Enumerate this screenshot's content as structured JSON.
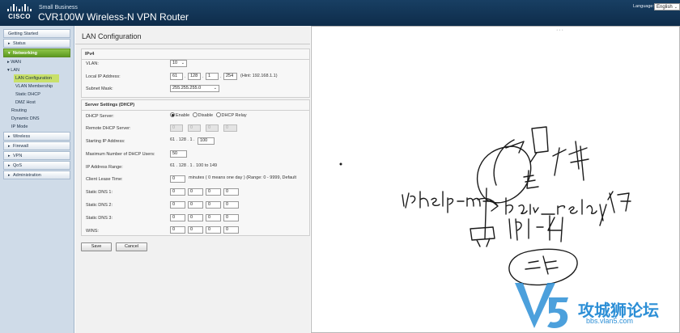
{
  "header": {
    "logo_text": "CISCO",
    "brand_line": "Small Business",
    "product_title": "CVR100W Wireless-N VPN Router",
    "language_label": "Language:",
    "language_value": "English"
  },
  "sidebar": {
    "items": [
      {
        "label": "Getting Started",
        "kind": "section"
      },
      {
        "label": "Status",
        "kind": "collapsed"
      },
      {
        "label": "Networking",
        "kind": "active"
      },
      {
        "label": "WAN",
        "kind": "sub-collapsed"
      },
      {
        "label": "LAN",
        "kind": "sub-expanded"
      },
      {
        "label": "LAN Configuration",
        "kind": "current"
      },
      {
        "label": "VLAN Membership",
        "kind": "leaf"
      },
      {
        "label": "Static DHCP",
        "kind": "leaf"
      },
      {
        "label": "DMZ Host",
        "kind": "leaf"
      },
      {
        "label": "Routing",
        "kind": "sub"
      },
      {
        "label": "Dynamic DNS",
        "kind": "sub"
      },
      {
        "label": "IP Mode",
        "kind": "sub"
      },
      {
        "label": "Wireless",
        "kind": "collapsed"
      },
      {
        "label": "Firewall",
        "kind": "collapsed"
      },
      {
        "label": "VPN",
        "kind": "collapsed"
      },
      {
        "label": "QoS",
        "kind": "collapsed"
      },
      {
        "label": "Administration",
        "kind": "collapsed"
      }
    ]
  },
  "main": {
    "title": "LAN Configuration",
    "ipv4": {
      "heading": "IPv4",
      "vlan_label": "VLAN:",
      "vlan_value": "10",
      "local_ip_label": "Local IP Address:",
      "local_ip": [
        "61",
        "128",
        "1",
        "254"
      ],
      "local_ip_hint": "(Hint: 192.168.1.1)",
      "subnet_label": "Subnet Mask:",
      "subnet_value": "255.255.255.0"
    },
    "dhcp": {
      "heading": "Server Settings (DHCP)",
      "server_label": "DHCP Server:",
      "options": [
        "Enable",
        "Disable",
        "DHCP Relay"
      ],
      "selected": "Enable",
      "remote_label": "Remote DHCP Server:",
      "remote_ip": [
        "0",
        "0",
        "0",
        "0"
      ],
      "start_label": "Starting IP Address:",
      "start_prefix": "61 . 128 . 1 .",
      "start_last": "100",
      "max_users_label": "Maximum Number of DHCP Users:",
      "max_users": "50",
      "range_label": "IP Address Range:",
      "range_value": "61 . 128 . 1 . 100 to 149",
      "lease_label": "Client Lease Time:",
      "lease_value": "0",
      "lease_hint": "minutes ( 0 means one day ) (Range: 0 - 9999, Default",
      "dns1_label": "Static DNS 1:",
      "dns1": [
        "0",
        "0",
        "0",
        "0"
      ],
      "dns2_label": "Static DNS 2:",
      "dns2": [
        "0",
        "0",
        "0",
        "0"
      ],
      "dns3_label": "Static DNS 3:",
      "dns3": [
        "0",
        "0",
        "0",
        "0"
      ],
      "wins_label": "WINS:",
      "wins": [
        "0",
        "0",
        "0",
        "0"
      ]
    },
    "buttons": {
      "save": "Save",
      "cancel": "Cancel"
    }
  },
  "overlay": {
    "grip": "···",
    "ink_color": "#1a1a1a"
  },
  "watermark": {
    "text": "攻城狮论坛",
    "url": "bbs.vlan5.com",
    "color": "#2d8fd6"
  }
}
